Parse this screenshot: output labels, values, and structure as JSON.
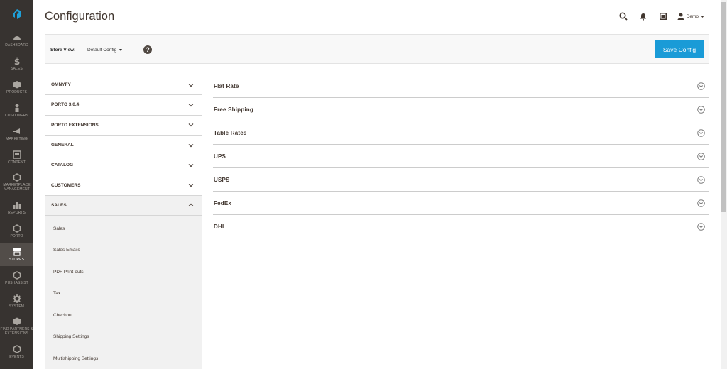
{
  "page": {
    "title": "Configuration"
  },
  "nav": {
    "items": [
      {
        "label": "DASHBOARD",
        "icon": "dashboard-icon"
      },
      {
        "label": "SALES",
        "icon": "dollar-icon"
      },
      {
        "label": "PRODUCTS",
        "icon": "cube-icon"
      },
      {
        "label": "CUSTOMERS",
        "icon": "person-icon"
      },
      {
        "label": "MARKETING",
        "icon": "megaphone-icon"
      },
      {
        "label": "CONTENT",
        "icon": "content-icon"
      },
      {
        "label": "MARKETPLACE MANAGEMENT",
        "icon": "hexagon-icon"
      },
      {
        "label": "REPORTS",
        "icon": "bar-chart-icon"
      },
      {
        "label": "PORTO",
        "icon": "hexagon-icon"
      },
      {
        "label": "STORES",
        "icon": "store-icon"
      },
      {
        "label": "PUSHASSIST",
        "icon": "hexagon-icon"
      },
      {
        "label": "SYSTEM",
        "icon": "gear-icon"
      },
      {
        "label": "FIND PARTNERS & EXTENSIONS",
        "icon": "cubes-icon"
      },
      {
        "label": "EVENTS",
        "icon": "hexagon-icon"
      }
    ]
  },
  "header": {
    "user_name": "Demo"
  },
  "store_view": {
    "label": "Store View:",
    "value": "Default Config",
    "help": "?"
  },
  "toolbar": {
    "save_label": "Save Config"
  },
  "tabs": [
    {
      "label": "OMNYFY"
    },
    {
      "label": "PORTO 3.0.4"
    },
    {
      "label": "PORTO EXTENSIONS"
    },
    {
      "label": "GENERAL"
    },
    {
      "label": "CATALOG"
    },
    {
      "label": "CUSTOMERS"
    },
    {
      "label": "SALES"
    }
  ],
  "sales_items": [
    {
      "label": "Sales"
    },
    {
      "label": "Sales Emails"
    },
    {
      "label": "PDF Print-outs"
    },
    {
      "label": "Tax"
    },
    {
      "label": "Checkout"
    },
    {
      "label": "Shipping Settings"
    },
    {
      "label": "Multishipping Settings"
    }
  ],
  "sections": [
    {
      "label": "Flat Rate"
    },
    {
      "label": "Free Shipping"
    },
    {
      "label": "Table Rates"
    },
    {
      "label": "UPS"
    },
    {
      "label": "USPS"
    },
    {
      "label": "FedEx"
    },
    {
      "label": "DHL"
    }
  ],
  "colors": {
    "nav_bg": "#373330",
    "accent": "#1a9bd7",
    "nav_active": "#524d49"
  }
}
